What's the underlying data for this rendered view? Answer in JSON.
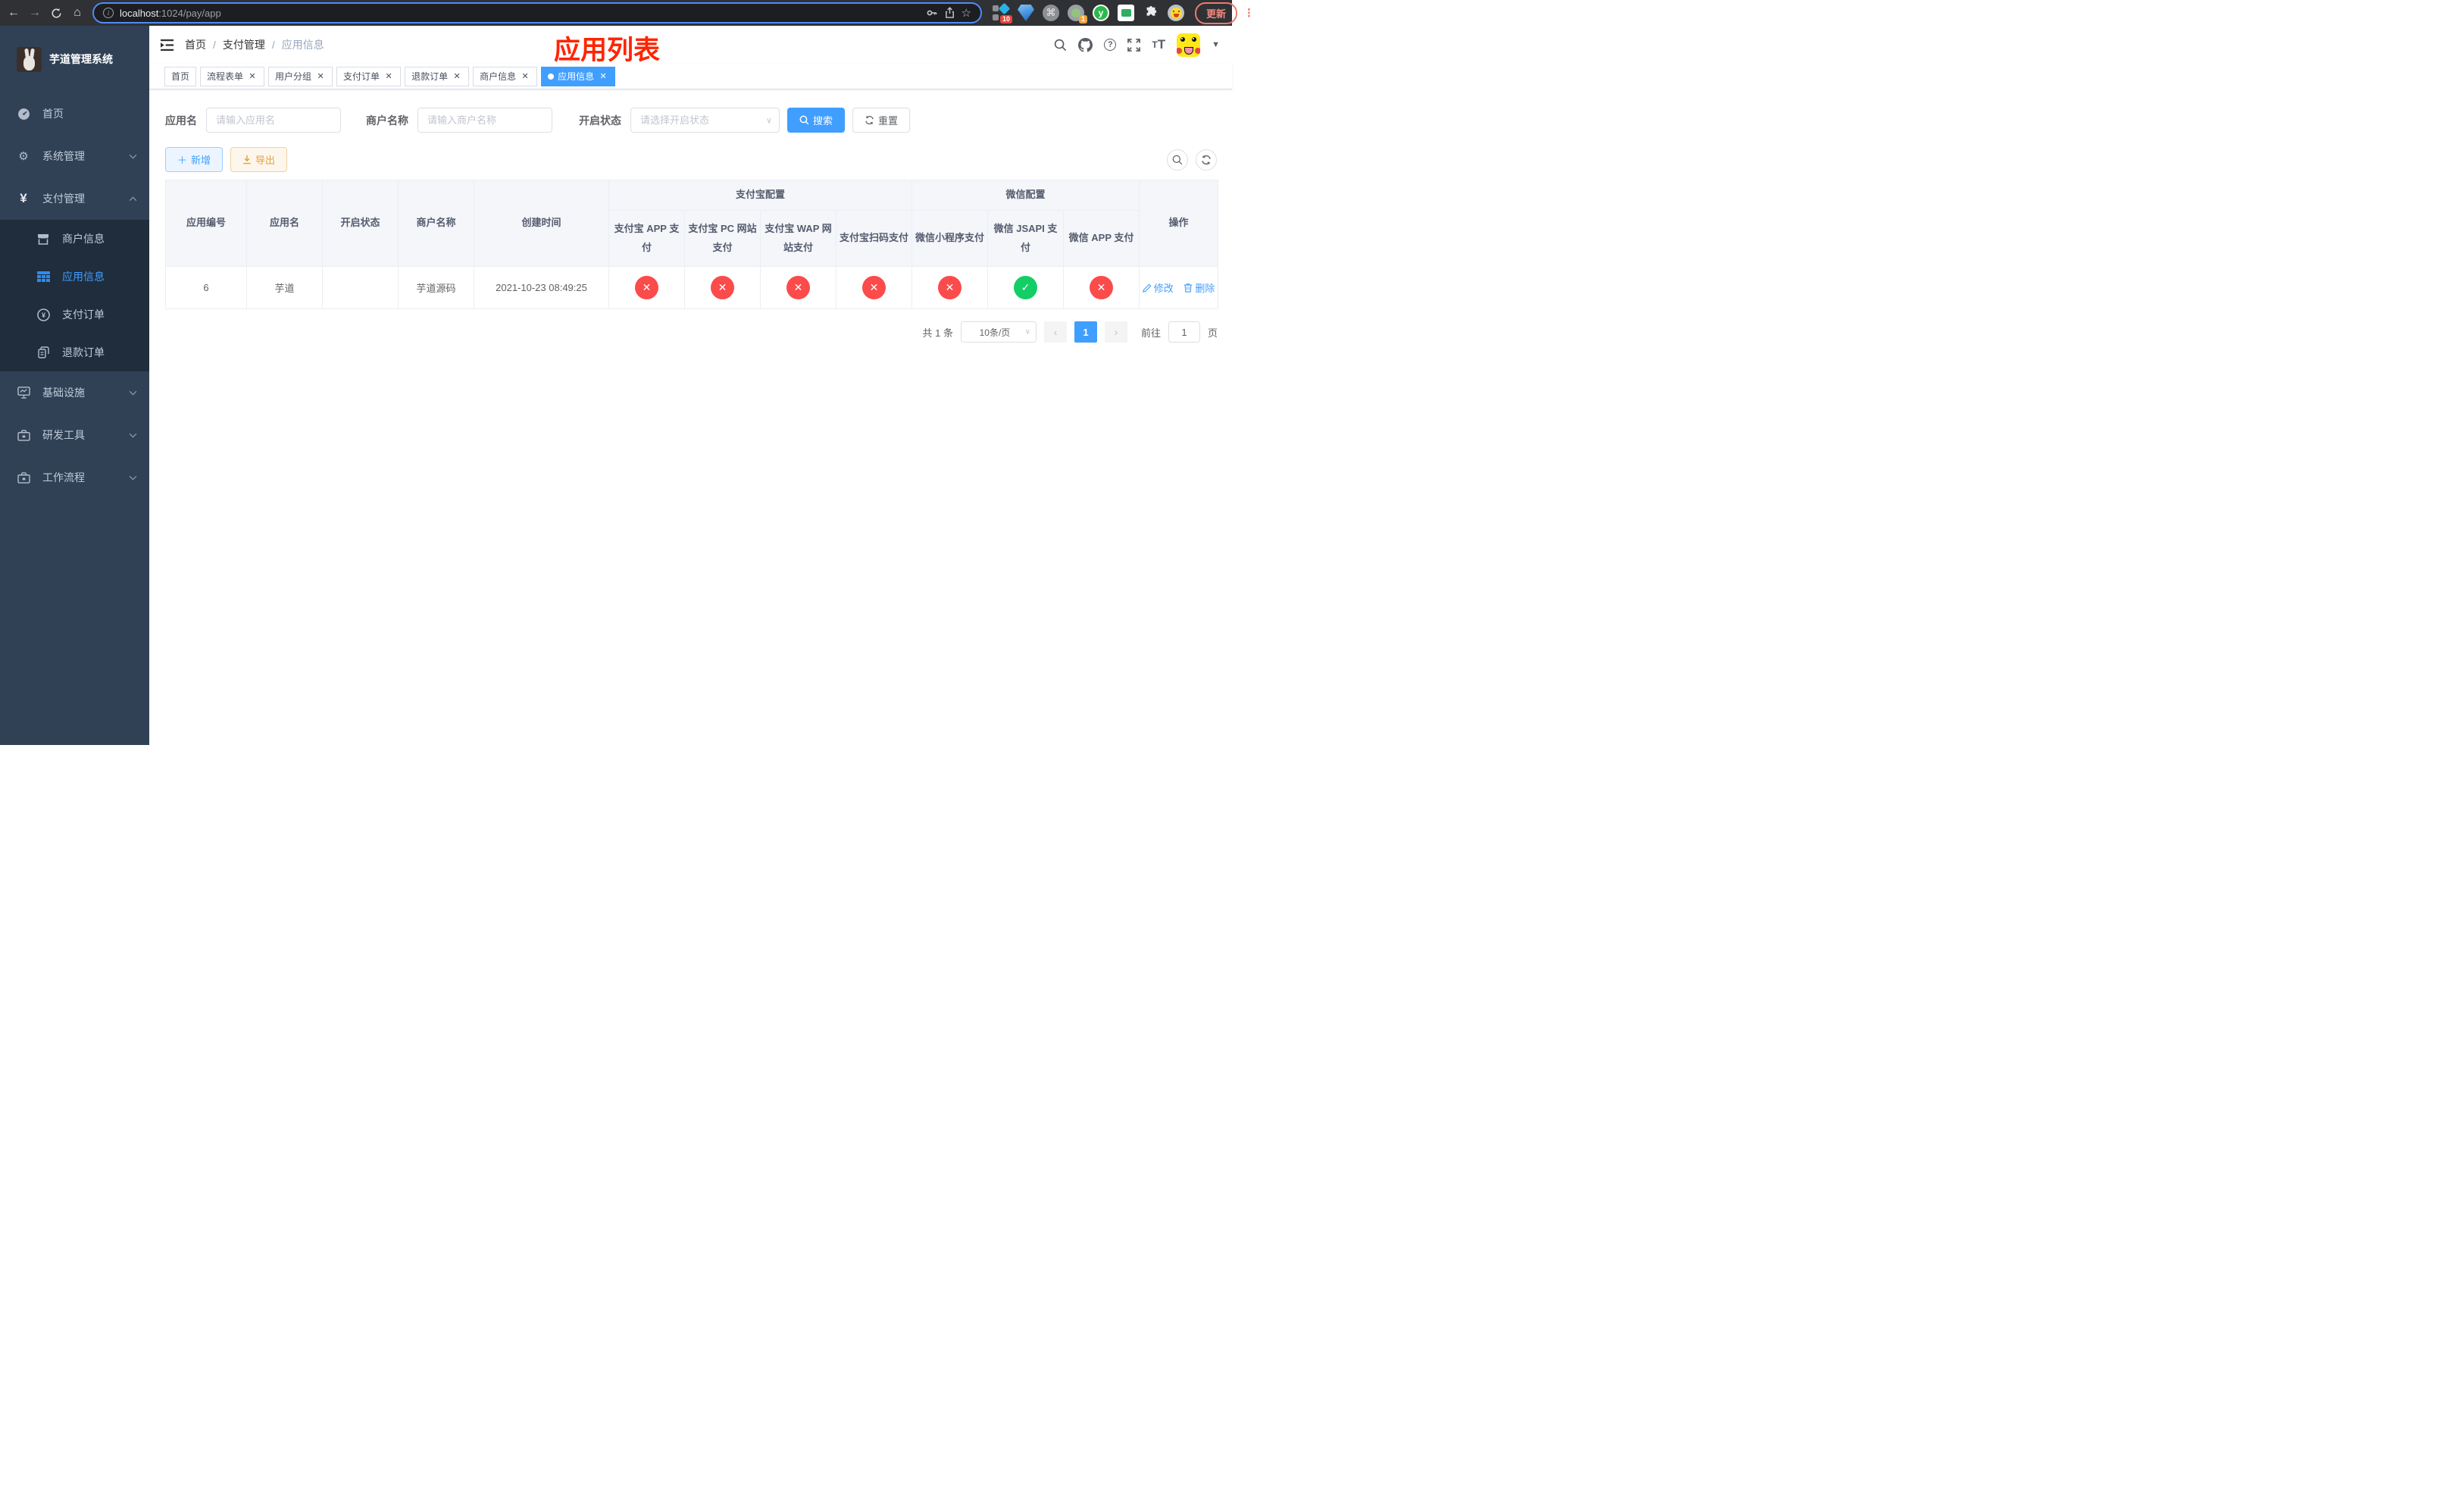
{
  "browser": {
    "url_domain": "localhost",
    "url_rest": ":1024/pay/app",
    "ext_badge_scripts": "10",
    "ext_badge_avatar": "1",
    "update_label": "更新"
  },
  "sidebar": {
    "title": "芋道管理系统",
    "items": [
      {
        "label": "首页",
        "icon": "dashboard-icon"
      },
      {
        "label": "系统管理",
        "icon": "gear-icon"
      },
      {
        "label": "支付管理",
        "icon": "yen-icon"
      },
      {
        "label": "商户信息",
        "icon": "store-icon"
      },
      {
        "label": "应用信息",
        "icon": "grid-icon"
      },
      {
        "label": "支付订单",
        "icon": "pay-order-icon"
      },
      {
        "label": "退款订单",
        "icon": "refund-icon"
      },
      {
        "label": "基础设施",
        "icon": "monitor-icon"
      },
      {
        "label": "研发工具",
        "icon": "toolbox-icon"
      },
      {
        "label": "工作流程",
        "icon": "toolbox-icon"
      }
    ]
  },
  "navbar": {
    "breadcrumb": [
      {
        "label": "首页"
      },
      {
        "label": "支付管理"
      },
      {
        "label": "应用信息"
      }
    ],
    "annotation": "应用列表"
  },
  "tags": [
    {
      "label": "首页",
      "closable": false,
      "active": false
    },
    {
      "label": "流程表单",
      "closable": true,
      "active": false
    },
    {
      "label": "用户分组",
      "closable": true,
      "active": false
    },
    {
      "label": "支付订单",
      "closable": true,
      "active": false
    },
    {
      "label": "退款订单",
      "closable": true,
      "active": false
    },
    {
      "label": "商户信息",
      "closable": true,
      "active": false
    },
    {
      "label": "应用信息",
      "closable": true,
      "active": true
    }
  ],
  "filters": {
    "app_name_label": "应用名",
    "app_name_placeholder": "请输入应用名",
    "merchant_label": "商户名称",
    "merchant_placeholder": "请输入商户名称",
    "status_label": "开启状态",
    "status_placeholder": "请选择开启状态",
    "search_label": "搜索",
    "reset_label": "重置"
  },
  "toolbar": {
    "add_label": "新增",
    "export_label": "导出"
  },
  "table": {
    "group_alipay": "支付宝配置",
    "group_wechat": "微信配置",
    "col_id": "应用编号",
    "col_name": "应用名",
    "col_status": "开启状态",
    "col_merchant": "商户名称",
    "col_created": "创建时间",
    "col_alipay_app": "支付宝 APP 支付",
    "col_alipay_pc": "支付宝 PC 网站支付",
    "col_alipay_wap": "支付宝 WAP 网站支付",
    "col_alipay_qr": "支付宝扫码支付",
    "col_wx_mini": "微信小程序支付",
    "col_wx_jsapi": "微信 JSAPI 支付",
    "col_wx_app": "微信 APP 支付",
    "col_actions": "操作",
    "row": {
      "id": "6",
      "name": "芋道",
      "enabled": true,
      "merchant": "芋道源码",
      "created": "2021-10-23 08:49:25",
      "alipay_app": false,
      "alipay_pc": false,
      "alipay_wap": false,
      "alipay_qr": false,
      "wx_mini": false,
      "wx_jsapi": true,
      "wx_app": false,
      "edit_label": "修改",
      "delete_label": "删除"
    }
  },
  "pagination": {
    "total_text": "共 1 条",
    "page_size": "10条/页",
    "current_page": "1",
    "goto_label": "前往",
    "goto_value": "1",
    "goto_unit": "页"
  },
  "colors": {
    "accent_blue": "#409eff",
    "status_red": "#fb4b4b",
    "status_green": "#13ce66",
    "annotation_red": "#ff2400",
    "sidebar_bg": "#304156",
    "submenu_bg": "#1f2d3d"
  }
}
